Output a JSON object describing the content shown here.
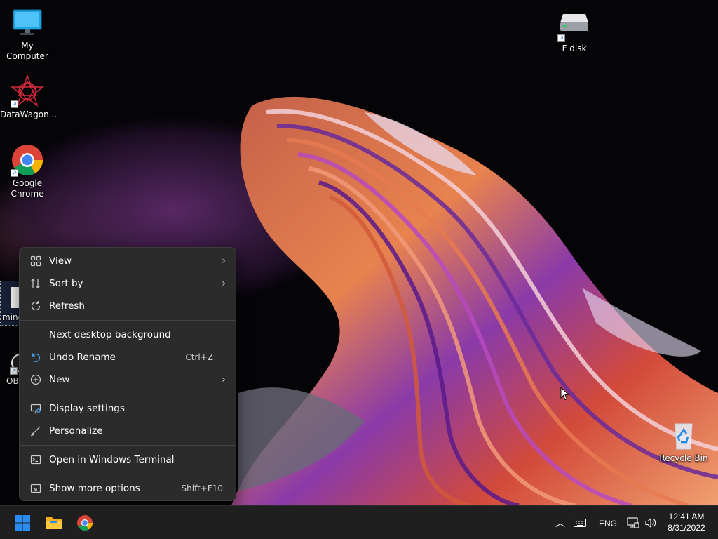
{
  "desktop": {
    "icons": [
      {
        "label": "My Computer"
      },
      {
        "label": "DataWagon..."
      },
      {
        "label": "Google\nChrome"
      },
      {
        "label": "mine"
      },
      {
        "label": "OB"
      },
      {
        "label": "F disk"
      },
      {
        "label": "Recycle Bin"
      }
    ]
  },
  "context_menu": {
    "items": [
      {
        "label": "View",
        "icon": "view-grid-icon",
        "submenu": true
      },
      {
        "label": "Sort by",
        "icon": "sort-icon",
        "submenu": true
      },
      {
        "label": "Refresh",
        "icon": "refresh-icon"
      },
      {
        "label": "Next desktop background"
      },
      {
        "label": "Undo Rename",
        "icon": "undo-icon",
        "shortcut": "Ctrl+Z"
      },
      {
        "label": "New",
        "icon": "new-plus-icon",
        "submenu": true
      },
      {
        "label": "Display settings",
        "icon": "display-icon"
      },
      {
        "label": "Personalize",
        "icon": "brush-icon"
      },
      {
        "label": "Open in Windows Terminal",
        "icon": "terminal-icon"
      },
      {
        "label": "Show more options",
        "icon": "more-options-icon",
        "shortcut": "Shift+F10"
      }
    ]
  },
  "taskbar": {
    "language": "ENG",
    "time": "12:41 AM",
    "date": "8/31/2022"
  },
  "colors": {
    "menu_bg": "#2b2b2b",
    "taskbar_bg": "#1f1f1f",
    "windows_blue": "#2a8cf0"
  }
}
